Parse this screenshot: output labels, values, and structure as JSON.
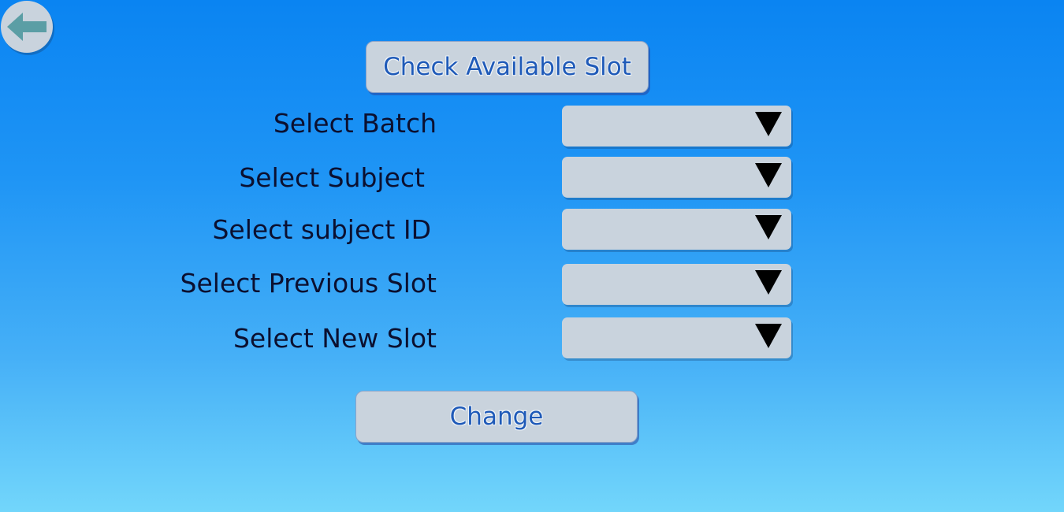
{
  "buttons": {
    "check_available_slot": "Check Available Slot",
    "change": "Change"
  },
  "form": {
    "rows": [
      {
        "label": "Select Batch",
        "value": ""
      },
      {
        "label": "Select Subject",
        "value": ""
      },
      {
        "label": "Select subject ID",
        "value": ""
      },
      {
        "label": "Select Previous Slot",
        "value": ""
      },
      {
        "label": "Select New Slot",
        "value": ""
      }
    ]
  },
  "icons": {
    "back": "arrow-left-icon",
    "dropdown": "triangle-down-icon"
  },
  "colors": {
    "button_bg": "#c9d3dd",
    "button_text": "#1f5ab8",
    "back_arrow": "#5b9ea5",
    "label_text": "#0b1030"
  }
}
